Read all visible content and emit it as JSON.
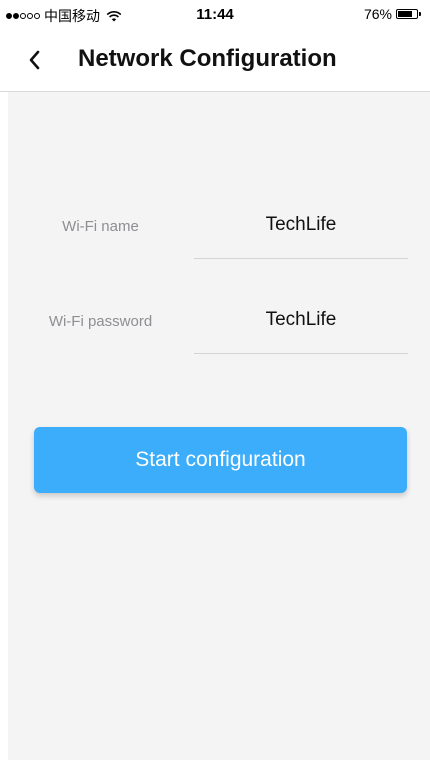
{
  "status_bar": {
    "carrier": "中国移动",
    "time": "11:44",
    "battery": "76%",
    "battery_level": 0.76,
    "signal_bars_filled": 2,
    "signal_bars_total": 5
  },
  "nav": {
    "back_icon": "chevron-left-icon",
    "title": "Network Configuration"
  },
  "form": {
    "wifi_name_label": "Wi-Fi name",
    "wifi_name_value": "TechLife",
    "wifi_password_label": "Wi-Fi password",
    "wifi_password_value": "TechLife"
  },
  "actions": {
    "start_label": "Start configuration"
  },
  "colors": {
    "accent": "#3badfa",
    "background": "#f4f4f5"
  }
}
